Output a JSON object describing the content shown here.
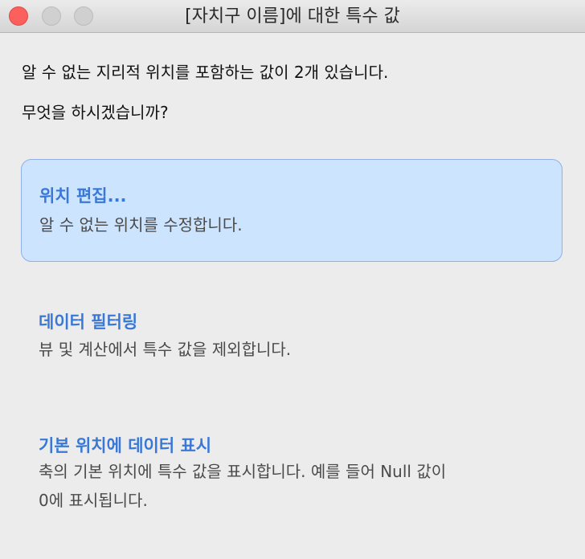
{
  "window": {
    "title": "[자치구 이름]에 대한 특수 값"
  },
  "message": {
    "line1": "알 수 없는 지리적 위치를 포함하는 값이 2개 있습니다.",
    "line2": "무엇을 하시겠습니까?"
  },
  "options": [
    {
      "title": "위치 편집...",
      "description": "알 수 없는 위치를 수정합니다.",
      "selected": true
    },
    {
      "title": "데이터 필터링",
      "description": "뷰 및 계산에서 특수 값을 제외합니다."
    },
    {
      "title": "기본 위치에 데이터 표시",
      "description_line1": "축의 기본 위치에 특수 값을 표시합니다. 예를 들어 Null 값이",
      "description_line2": "0에 표시됩니다."
    }
  ],
  "colors": {
    "accent": "#3a78d6",
    "selected_bg": "#cde4fe",
    "close_button": "#fc605c"
  }
}
